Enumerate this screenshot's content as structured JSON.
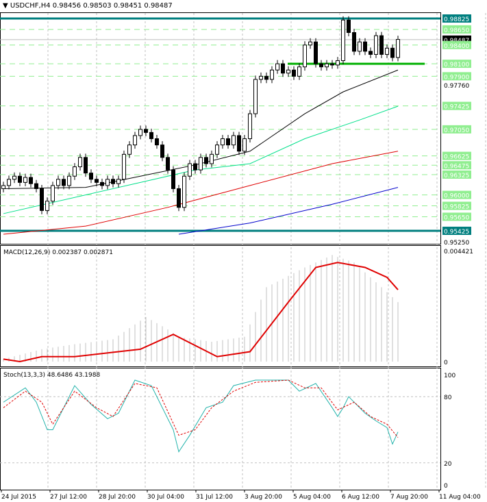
{
  "header": {
    "symbol": "USDCHF,H4",
    "open": "0.98456",
    "high": "0.98503",
    "low": "0.98451",
    "close": "0.98487"
  },
  "macd": {
    "label": "MACD(12,26,9) 0.002387 0.002871",
    "max_label": "0.004421",
    "zero_label": "0"
  },
  "stoch": {
    "label": "Stoch(13,3,3) 48.6486 43.1988",
    "levels": [
      "100",
      "80",
      "20",
      "0"
    ]
  },
  "colors": {
    "bull": "#ffffff",
    "bear": "#000000",
    "ma_black": "#000000",
    "ma_green": "#00e08a",
    "ma_red": "#e00000",
    "ma_blue": "#0000cc",
    "level_teal": "#007f7f",
    "level_green": "#90ee90",
    "macd_signal": "#e00000",
    "stoch_main": "#20b2aa",
    "stoch_signal": "#e00000"
  },
  "chart_data": {
    "type": "candlestick",
    "ylim": [
      0.9525,
      0.991
    ],
    "price_labels": [
      "0.98825",
      "0.98650",
      "0.98487",
      "0.98400",
      "0.98100",
      "0.97900",
      "0.97760",
      "0.97425",
      "0.97050",
      "0.96625",
      "0.96475",
      "0.96325",
      "0.96000",
      "0.95825",
      "0.95650",
      "0.95425",
      "0.95250"
    ],
    "teal_levels": [
      0.98825,
      0.95425
    ],
    "green_levels": [
      0.9865,
      0.984,
      0.981,
      0.979,
      0.97425,
      0.9705,
      0.96625,
      0.96475,
      0.96325,
      0.96,
      0.95825,
      0.9565
    ],
    "current_price": 0.98487,
    "x_labels": [
      "24 Jul 2015",
      "27 Jul 12:00",
      "28 Jul 20:00",
      "30 Jul 04:00",
      "31 Jul 12:00",
      "3 Aug 20:00",
      "5 Aug 04:00",
      "6 Aug 12:00",
      "7 Aug 20:00",
      "11 Aug 04:00"
    ],
    "closes": [
      0.9615,
      0.9625,
      0.963,
      0.962,
      0.9628,
      0.9618,
      0.961,
      0.9575,
      0.959,
      0.9615,
      0.9625,
      0.9615,
      0.963,
      0.9645,
      0.966,
      0.9635,
      0.9625,
      0.962,
      0.9615,
      0.9625,
      0.9618,
      0.9625,
      0.9665,
      0.968,
      0.9695,
      0.9705,
      0.97,
      0.969,
      0.968,
      0.966,
      0.964,
      0.961,
      0.958,
      0.963,
      0.965,
      0.964,
      0.966,
      0.965,
      0.9665,
      0.968,
      0.969,
      0.968,
      0.9695,
      0.967,
      0.969,
      0.973,
      0.9785,
      0.979,
      0.9785,
      0.98,
      0.981,
      0.9795,
      0.98,
      0.979,
      0.9805,
      0.984,
      0.9845,
      0.981,
      0.9805,
      0.981,
      0.9808,
      0.9815,
      0.988,
      0.986,
      0.983,
      0.9845,
      0.983,
      0.9825,
      0.9855,
      0.9825,
      0.9835,
      0.982,
      0.9849
    ],
    "moving_averages": [
      {
        "name": "ma-black",
        "points": [
          [
            0,
            0.961
          ],
          [
            15,
            0.9612
          ],
          [
            25,
            0.963
          ],
          [
            35,
            0.9648
          ],
          [
            45,
            0.967
          ],
          [
            55,
            0.973
          ],
          [
            62,
            0.9765
          ],
          [
            72,
            0.98
          ]
        ]
      },
      {
        "name": "ma-green",
        "points": [
          [
            0,
            0.957
          ],
          [
            15,
            0.96
          ],
          [
            25,
            0.962
          ],
          [
            35,
            0.964
          ],
          [
            45,
            0.965
          ],
          [
            55,
            0.969
          ],
          [
            65,
            0.972
          ],
          [
            72,
            0.9742
          ]
        ]
      },
      {
        "name": "ma-red",
        "points": [
          [
            0,
            0.9537
          ],
          [
            15,
            0.955
          ],
          [
            30,
            0.958
          ],
          [
            45,
            0.9615
          ],
          [
            60,
            0.965
          ],
          [
            72,
            0.967
          ]
        ]
      },
      {
        "name": "ma-blue",
        "points": [
          [
            32,
            0.9537
          ],
          [
            45,
            0.9555
          ],
          [
            60,
            0.9585
          ],
          [
            72,
            0.9612
          ]
        ]
      }
    ],
    "macd_main": [
      [
        0,
        0.0001
      ],
      [
        7,
        0.0005
      ],
      [
        13,
        0.0007
      ],
      [
        20,
        0.0009
      ],
      [
        26,
        0.0018
      ],
      [
        30,
        0.0013
      ],
      [
        32,
        0.001
      ],
      [
        38,
        0.0008
      ],
      [
        44,
        0.001
      ],
      [
        48,
        0.003
      ],
      [
        55,
        0.0038
      ],
      [
        60,
        0.0043
      ],
      [
        64,
        0.004
      ],
      [
        69,
        0.003
      ],
      [
        72,
        0.0024
      ]
    ],
    "macd_signal": [
      [
        0,
        0.0001
      ],
      [
        3,
        0.0
      ],
      [
        7,
        0.0002
      ],
      [
        13,
        0.0002
      ],
      [
        21,
        0.0004
      ],
      [
        25,
        0.0005
      ],
      [
        31,
        0.0011
      ],
      [
        39,
        0.0002
      ],
      [
        45,
        0.0004
      ],
      [
        52,
        0.0024
      ],
      [
        57,
        0.0038
      ],
      [
        61,
        0.004
      ],
      [
        66,
        0.0038
      ],
      [
        70,
        0.0034
      ],
      [
        72,
        0.0029
      ]
    ],
    "stoch_main": [
      [
        0,
        75
      ],
      [
        4,
        88
      ],
      [
        6,
        75
      ],
      [
        8,
        50
      ],
      [
        9,
        50
      ],
      [
        13,
        90
      ],
      [
        16,
        73
      ],
      [
        19,
        60
      ],
      [
        21,
        65
      ],
      [
        24,
        95
      ],
      [
        27,
        90
      ],
      [
        31,
        50
      ],
      [
        32,
        30
      ],
      [
        34,
        45
      ],
      [
        37,
        70
      ],
      [
        40,
        75
      ],
      [
        42,
        90
      ],
      [
        46,
        95
      ],
      [
        49,
        95
      ],
      [
        52,
        95
      ],
      [
        54,
        85
      ],
      [
        57,
        92
      ],
      [
        60,
        70
      ],
      [
        61,
        62
      ],
      [
        62,
        70
      ],
      [
        63,
        80
      ],
      [
        66,
        65
      ],
      [
        68,
        58
      ],
      [
        70,
        52
      ],
      [
        71,
        37
      ],
      [
        72,
        48
      ]
    ],
    "stoch_signal": [
      [
        0,
        70
      ],
      [
        4,
        85
      ],
      [
        7,
        75
      ],
      [
        9,
        55
      ],
      [
        13,
        85
      ],
      [
        17,
        70
      ],
      [
        20,
        62
      ],
      [
        24,
        92
      ],
      [
        28,
        88
      ],
      [
        32,
        45
      ],
      [
        35,
        50
      ],
      [
        38,
        70
      ],
      [
        42,
        85
      ],
      [
        46,
        93
      ],
      [
        52,
        95
      ],
      [
        55,
        88
      ],
      [
        58,
        88
      ],
      [
        61,
        68
      ],
      [
        64,
        75
      ],
      [
        67,
        62
      ],
      [
        70,
        55
      ],
      [
        72,
        43
      ]
    ]
  }
}
